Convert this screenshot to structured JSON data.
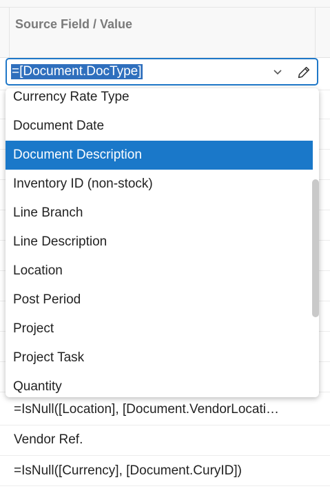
{
  "grid": {
    "column_header": "Source Field / Value"
  },
  "editor": {
    "value": "=[Document.DocType]",
    "dropdown_icon": "chevron-down-icon",
    "edit_icon": "pencil-icon"
  },
  "dropdown": {
    "selected": "Document Description",
    "options": [
      "Currency Rate Type",
      "Document Date",
      "Document Description",
      "Inventory ID (non-stock)",
      "Line Branch",
      "Line Description",
      "Location",
      "Post Period",
      "Project",
      "Project Task",
      "Quantity"
    ]
  },
  "rows": [
    "=IsNull([Location], [Document.VendorLocati…",
    "Vendor Ref.",
    "=IsNull([Currency], [Document.CuryID])"
  ],
  "colors": {
    "accent": "#1a78c9",
    "selection": "#2f6fbd",
    "header_text": "#7a7a7a"
  }
}
